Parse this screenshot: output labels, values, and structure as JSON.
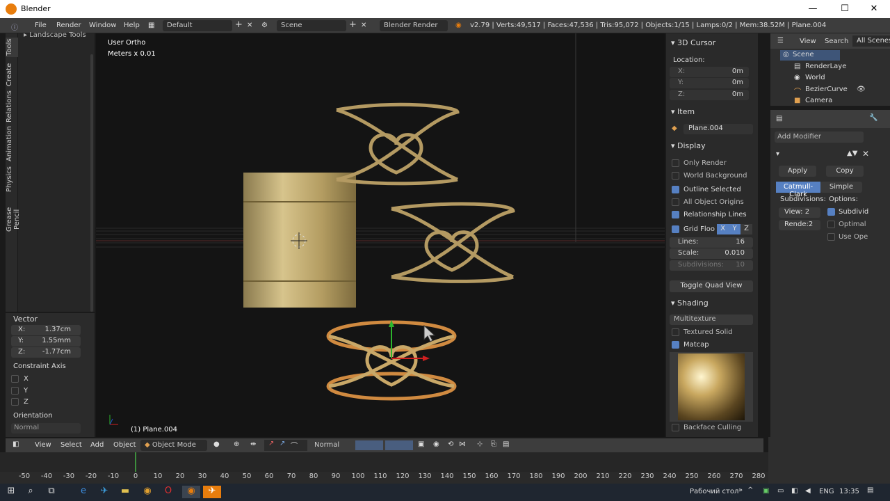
{
  "window": {
    "title": "Blender",
    "minimize": "—",
    "maximize": "☐",
    "close": "✕"
  },
  "menu": {
    "file": "File",
    "render": "Render",
    "window": "Window",
    "help": "Help",
    "layout": "Default",
    "scene": "Scene",
    "engine": "Blender Render"
  },
  "stats": "v2.79 | Verts:49,517 | Faces:47,536 | Tris:95,072 | Objects:1/15 | Lamps:0/2 | Mem:38.52M | Plane.004",
  "toolshelf": {
    "header": "Landscape Tools",
    "tabs": [
      "Tools",
      "Create",
      "Relations",
      "Animation",
      "Physics",
      "Grease Pencil"
    ]
  },
  "redo": {
    "title": "Vector",
    "x_label": "X:",
    "x": "1.37cm",
    "y_label": "Y:",
    "y": "1.55mm",
    "z_label": "Z:",
    "z": "-1.77cm",
    "constraint": "Constraint Axis",
    "cx": "X",
    "cy": "Y",
    "cz": "Z",
    "orientation": "Orientation",
    "orient_value": "Normal"
  },
  "viewport": {
    "view_name": "User Ortho",
    "units": "Meters x 0.01",
    "object": "(1) Plane.004"
  },
  "npanel": {
    "cursor_title": "3D Cursor",
    "location": "Location:",
    "cx_label": "X:",
    "cx": "0m",
    "cy_label": "Y:",
    "cy": "0m",
    "cz_label": "Z:",
    "cz": "0m",
    "item_title": "Item",
    "item_name": "Plane.004",
    "display_title": "Display",
    "only_render": "Only Render",
    "world_bg": "World Background",
    "outline": "Outline Selected",
    "all_origins": "All Object Origins",
    "rel_lines": "Relationship Lines",
    "grid_floor": "Grid Floo",
    "gx": "X",
    "gy": "Y",
    "gz": "Z",
    "lines_label": "Lines:",
    "lines": "16",
    "scale_label": "Scale:",
    "scale": "0.010",
    "subdiv_label": "Subdivisions:",
    "subdiv": "10",
    "toggle_quad": "Toggle Quad View",
    "shading_title": "Shading",
    "shading_mode": "Multitexture",
    "textured_solid": "Textured Solid",
    "matcap": "Matcap",
    "backface": "Backface Culling"
  },
  "outliner": {
    "view": "View",
    "search": "Search",
    "all_scenes": "All Scenes",
    "items": [
      "Scene",
      "RenderLaye",
      "World",
      "BezierCurve",
      "Camera"
    ]
  },
  "props": {
    "add_modifier": "Add Modifier",
    "apply": "Apply",
    "copy": "Copy",
    "catmull": "Catmull-Clark",
    "simple": "Simple",
    "subdivisions": "Subdivisions:",
    "options": "Options:",
    "view": "View: 2",
    "render": "Rende:2",
    "subdivid": "Subdivid",
    "optimal": "Optimal",
    "use_ope": "Use Ope"
  },
  "vheader": {
    "view": "View",
    "select": "Select",
    "add": "Add",
    "object": "Object",
    "mode": "Object Mode",
    "pivot": "Normal"
  },
  "timeline": {
    "ticks": [
      "-50",
      "-40",
      "-30",
      "-20",
      "-10",
      "0",
      "10",
      "20",
      "30",
      "40",
      "50",
      "60",
      "70",
      "80",
      "90",
      "100",
      "110",
      "120",
      "130",
      "140",
      "150",
      "160",
      "170",
      "180",
      "190",
      "200",
      "210",
      "220",
      "230",
      "240",
      "250",
      "260",
      "270",
      "280"
    ]
  },
  "taskbar": {
    "desktop": "Рабочий стол",
    "lang": "ENG",
    "time": "13:35"
  }
}
